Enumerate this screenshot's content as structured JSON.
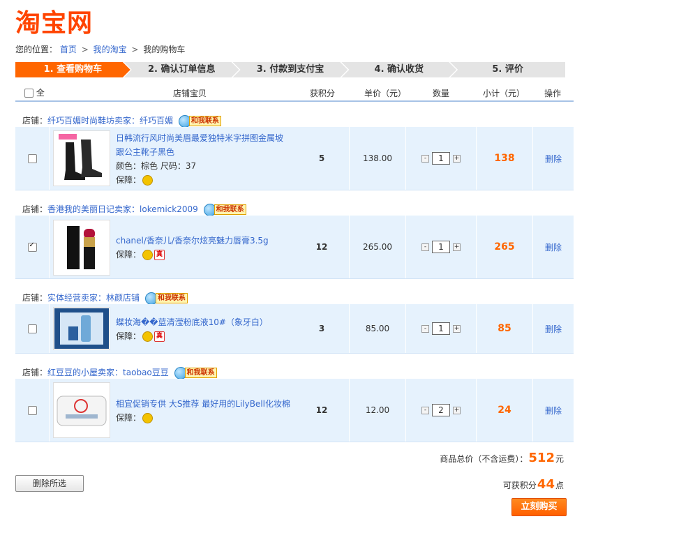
{
  "logo": "淘宝网",
  "breadcrumb": {
    "prefix": "您的位置：",
    "items": [
      "首页",
      "我的淘宝",
      "我的购物车"
    ],
    "sep": ">"
  },
  "steps": [
    "1. 查看购物车",
    "2. 确认订单信息",
    "3. 付款到支付宝",
    "4. 确认收货",
    "5. 评价"
  ],
  "table_header": {
    "select_all": "全",
    "item": "店铺宝贝",
    "points": "获积分",
    "unit_price": "单价（元）",
    "quantity": "数量",
    "subtotal": "小计（元）",
    "action": "操作"
  },
  "labels": {
    "shop_prefix": "店铺：",
    "seller_prefix": "卖家：",
    "contact": "和我联系",
    "guarantee": "保障：",
    "qty_minus": "-",
    "qty_plus": "+",
    "delete": "删除"
  },
  "shops": [
    {
      "shop_name": "纤巧百媚时尚鞋坊",
      "seller": "纤巧百媚",
      "item": {
        "title": "日韩流行风时尚美眉最爱独特米字拼图金属坡跟公主靴子黑色",
        "spec": "颜色：棕色 尺码：37",
        "points": "5",
        "price": "138.00",
        "qty": "1",
        "subtotal": "138",
        "checked": false,
        "badges": [
          "yellow"
        ]
      }
    },
    {
      "shop_name": "香港我的美丽日记",
      "seller": "lokemick2009",
      "item": {
        "title": "chanel/香奈儿/香奈尔炫亮魅力唇膏3.5g",
        "spec": "",
        "points": "12",
        "price": "265.00",
        "qty": "1",
        "subtotal": "265",
        "checked": true,
        "badges": [
          "yellow",
          "red"
        ]
      }
    },
    {
      "shop_name": "实体经营",
      "seller": "林颜店铺",
      "item": {
        "title": "蝶妆海��蓝清滢粉底液10#（象牙白）",
        "spec": "",
        "points": "3",
        "price": "85.00",
        "qty": "1",
        "subtotal": "85",
        "checked": false,
        "badges": [
          "yellow",
          "red"
        ]
      }
    },
    {
      "shop_name": "红豆豆的小屋",
      "seller": "taobao豆豆",
      "item": {
        "title": "相宜促销专供 大S推荐 最好用的LilyBell化妆棉",
        "spec": "",
        "points": "12",
        "price": "12.00",
        "qty": "2",
        "subtotal": "24",
        "checked": false,
        "badges": [
          "yellow"
        ]
      }
    }
  ],
  "footer": {
    "total_label": "商品总价（不含运费）：",
    "total_value": "512",
    "total_unit": "元",
    "points_label": "可获积分",
    "points_value": "44",
    "points_unit": "点",
    "delete_selected": "删除所选",
    "buy_now": "立刻购买"
  },
  "badge_text": {
    "red": "真"
  },
  "colors": {
    "accent": "#ff6600",
    "link": "#3366cc",
    "row_bg": "#e6f2fd"
  }
}
